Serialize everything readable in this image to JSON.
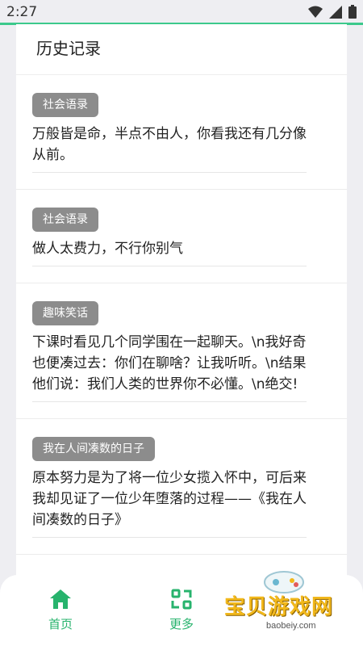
{
  "status_bar": {
    "time": "2:27"
  },
  "page": {
    "title": "历史记录"
  },
  "history": [
    {
      "tag": "社会语录",
      "text": "万般皆是命，半点不由人，你看我还有几分像从前。"
    },
    {
      "tag": "社会语录",
      "text": "做人太费力，不行你别气"
    },
    {
      "tag": "趣味笑话",
      "text": "下课时看见几个同学围在一起聊天。\\n我好奇也便凑过去：你们在聊啥？让我听听。\\n结果他们说：我们人类的世界你不必懂。\\n绝交!"
    },
    {
      "tag": "我在人间凑数的日子",
      "text": "原本努力是为了将一位少女揽入怀中，可后来我却见证了一位少年堕落的过程——《我在人间凑数的日子》"
    }
  ],
  "nav": {
    "home_label": "首页",
    "more_label": "更多",
    "accent": "#27b36d"
  },
  "watermark": {
    "name": "宝贝游戏网",
    "url": "baobeiy.com"
  }
}
